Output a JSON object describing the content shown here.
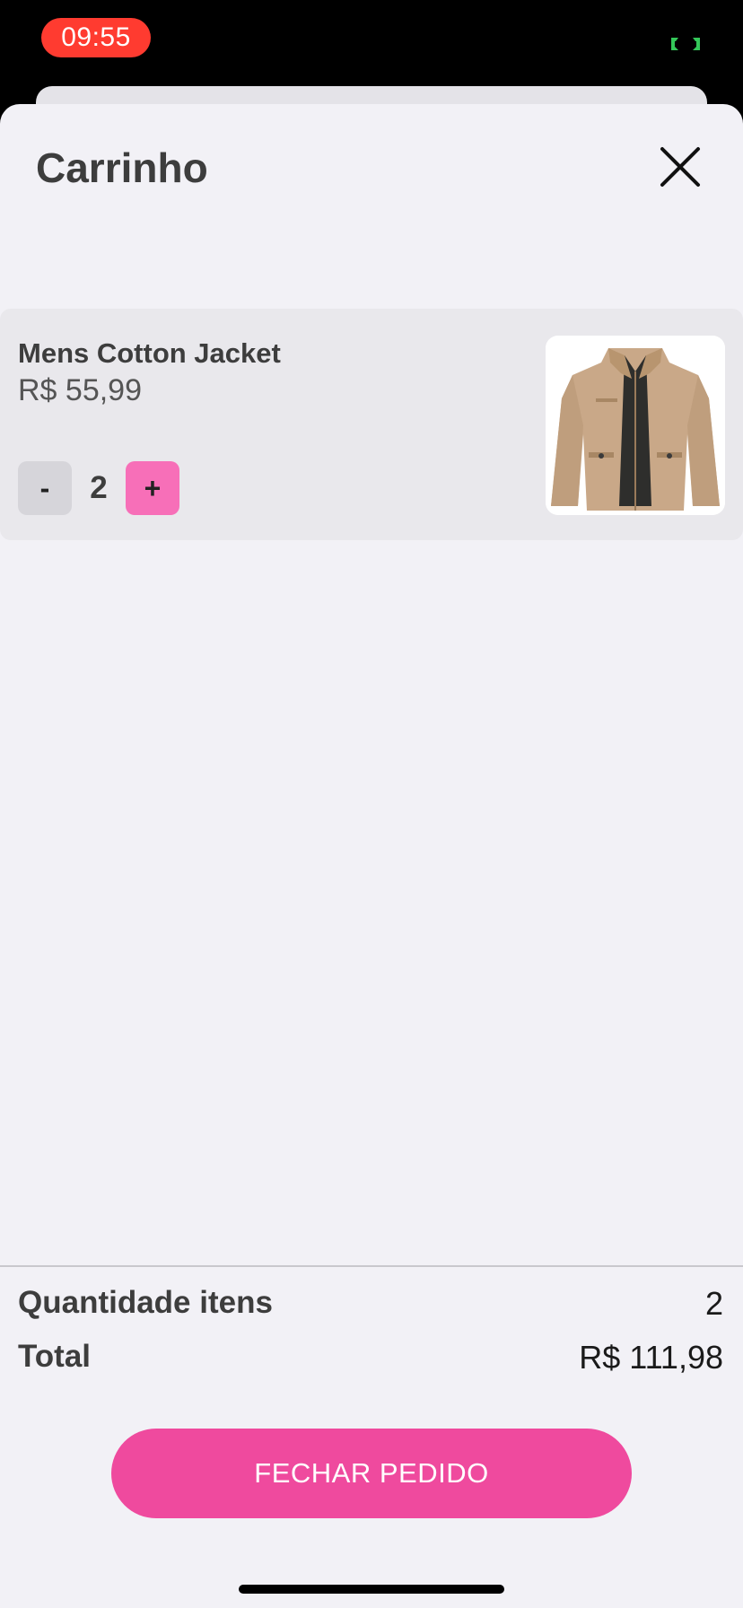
{
  "status_bar": {
    "time": "09:55",
    "indicator_icon": "screen-mirroring-icon",
    "indicator_color": "#34c759",
    "time_pill_color": "#ff3b30"
  },
  "cart": {
    "title": "Carrinho",
    "close_icon": "close-icon",
    "items": [
      {
        "name": "Mens Cotton Jacket",
        "price": "R$ 55,99",
        "quantity": "2",
        "minus_label": "-",
        "plus_label": "+",
        "image_icon": "jacket-image"
      }
    ]
  },
  "summary": {
    "quantity_label": "Quantidade itens",
    "quantity_value": "2",
    "total_label": "Total",
    "total_value": "R$ 111,98"
  },
  "checkout": {
    "label": "FECHAR PEDIDO",
    "color": "#ef4a9e"
  },
  "colors": {
    "accent": "#ef4a9e",
    "plus_button": "#f76fb8",
    "sheet_background": "#f2f1f6"
  }
}
